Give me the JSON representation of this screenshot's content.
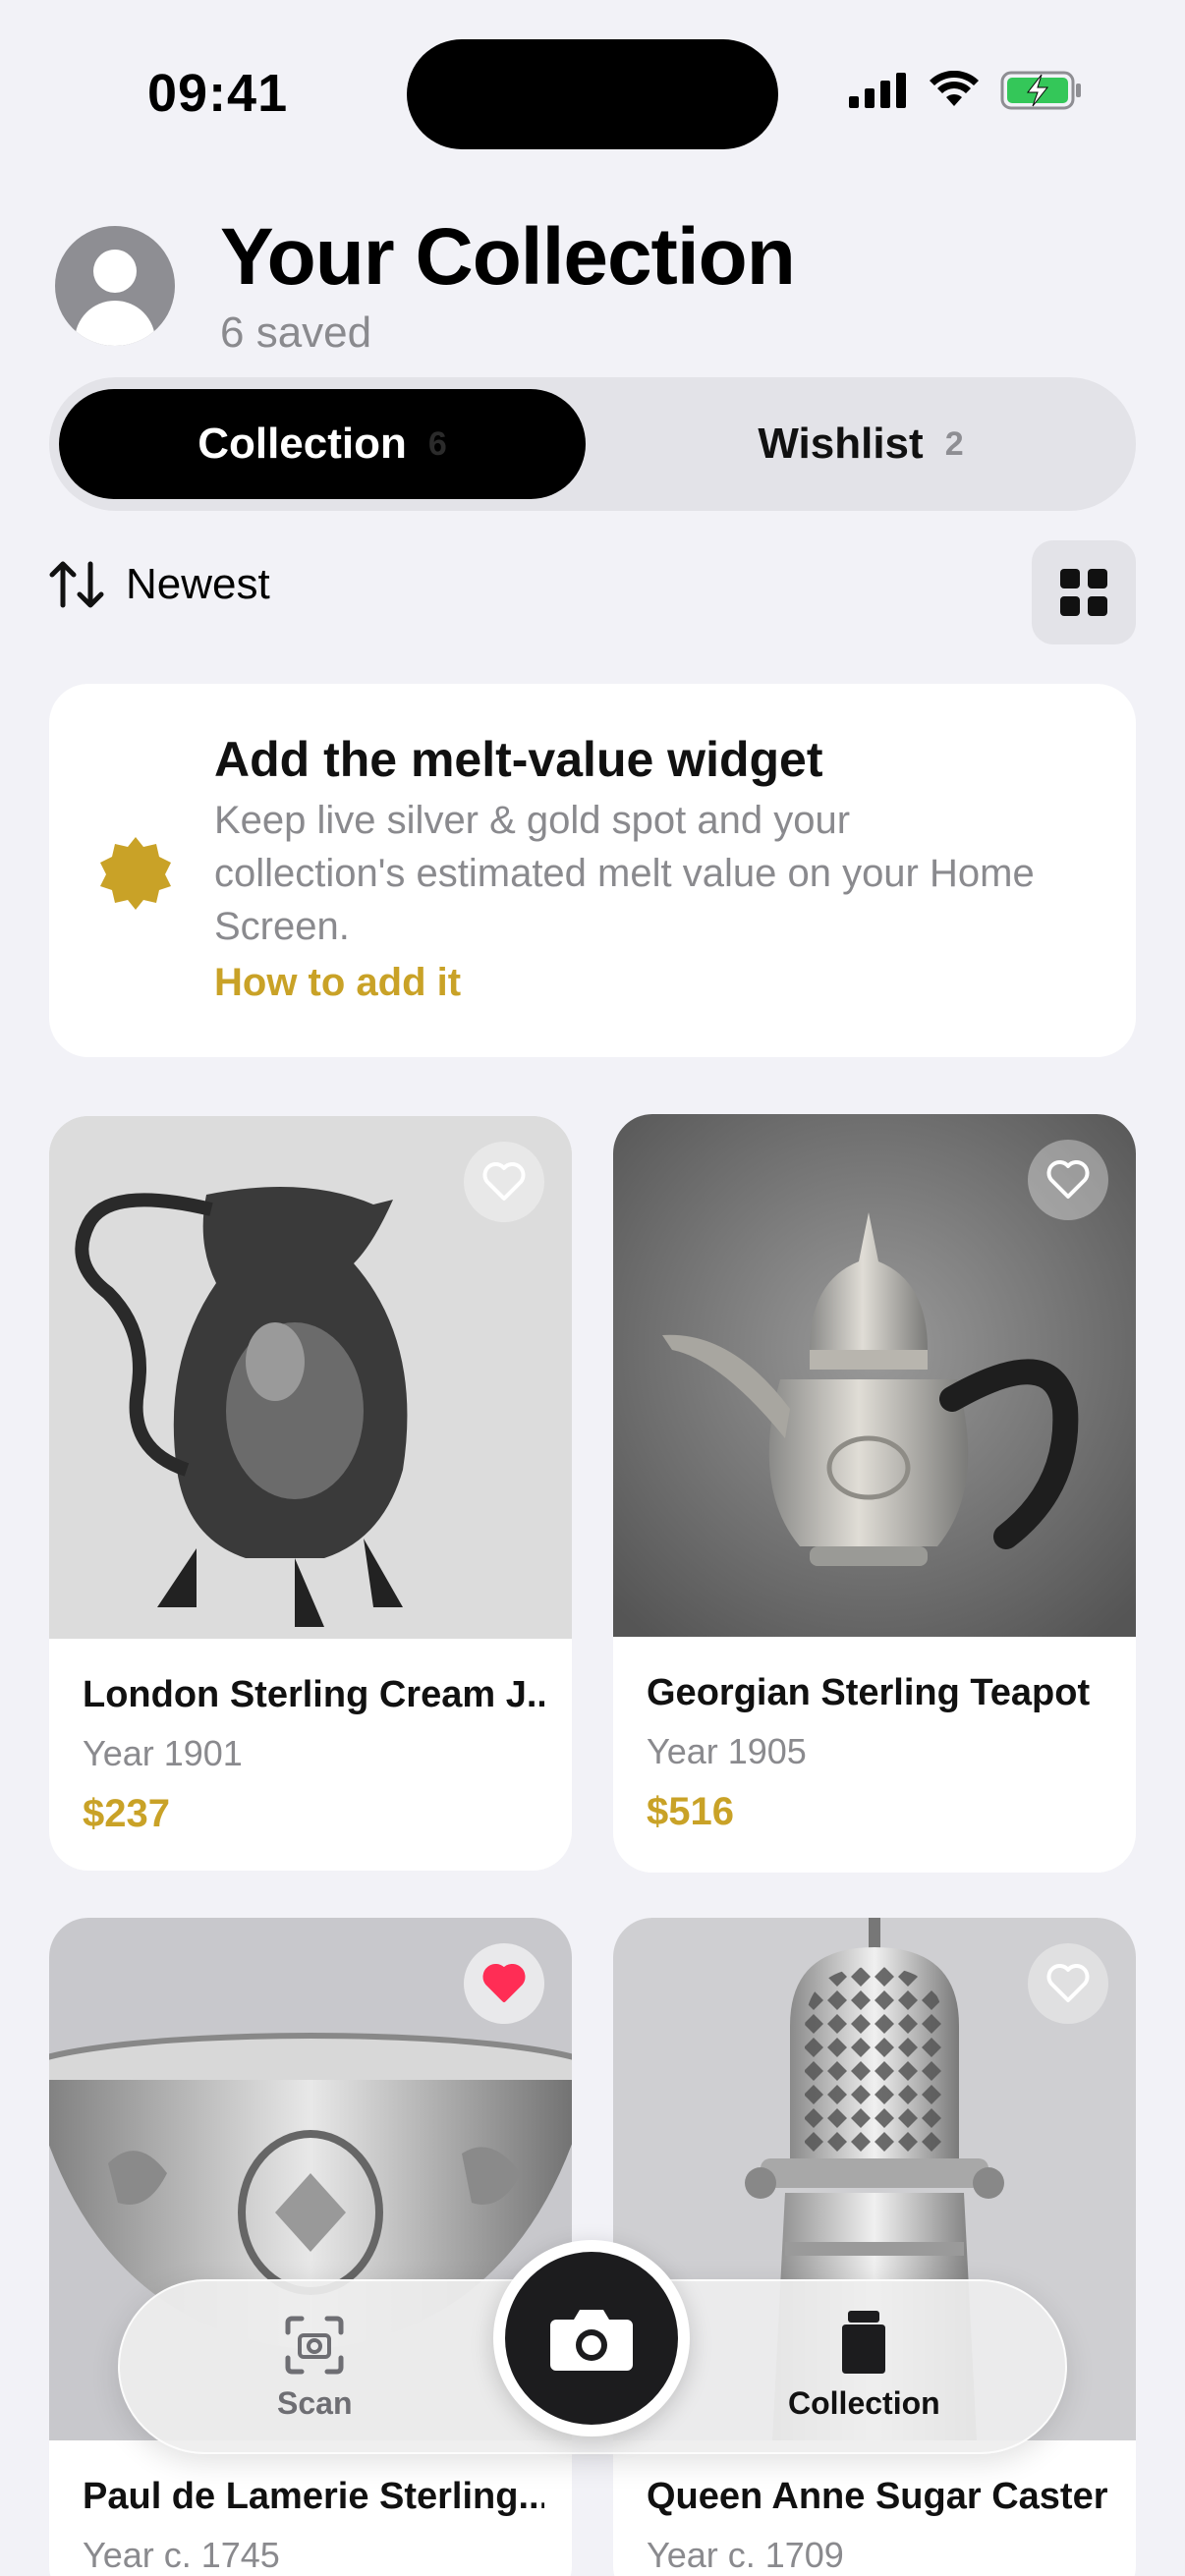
{
  "status_bar": {
    "time": "09:41"
  },
  "header": {
    "title": "Your Collection",
    "subtitle": "6 saved"
  },
  "segmented": {
    "collection_label": "Collection",
    "collection_count": "6",
    "wishlist_label": "Wishlist",
    "wishlist_count": "2"
  },
  "sort": {
    "label": "Newest"
  },
  "promo": {
    "title": "Add the melt-value widget",
    "body": "Keep live silver & gold spot and your collection's estimated melt value on your Home Screen.",
    "link": "How to add it"
  },
  "items": [
    {
      "name": "London Sterling Cream J...",
      "year": "Year 1901",
      "price": "$237",
      "favorited": false
    },
    {
      "name": "Georgian Sterling Teapot",
      "year": "Year 1905",
      "price": "$516",
      "favorited": false
    },
    {
      "name": "Paul de Lamerie Sterling...",
      "year": "Year c. 1745",
      "price": "",
      "favorited": true
    },
    {
      "name": "Queen Anne Sugar Caster",
      "year": "Year c. 1709",
      "price": "",
      "favorited": false
    }
  ],
  "tabbar": {
    "scan_label": "Scan",
    "collection_label": "Collection"
  },
  "colors": {
    "accent_gold": "#c9a227",
    "favorite_red": "#ff2d55",
    "background": "#f2f2f7"
  }
}
